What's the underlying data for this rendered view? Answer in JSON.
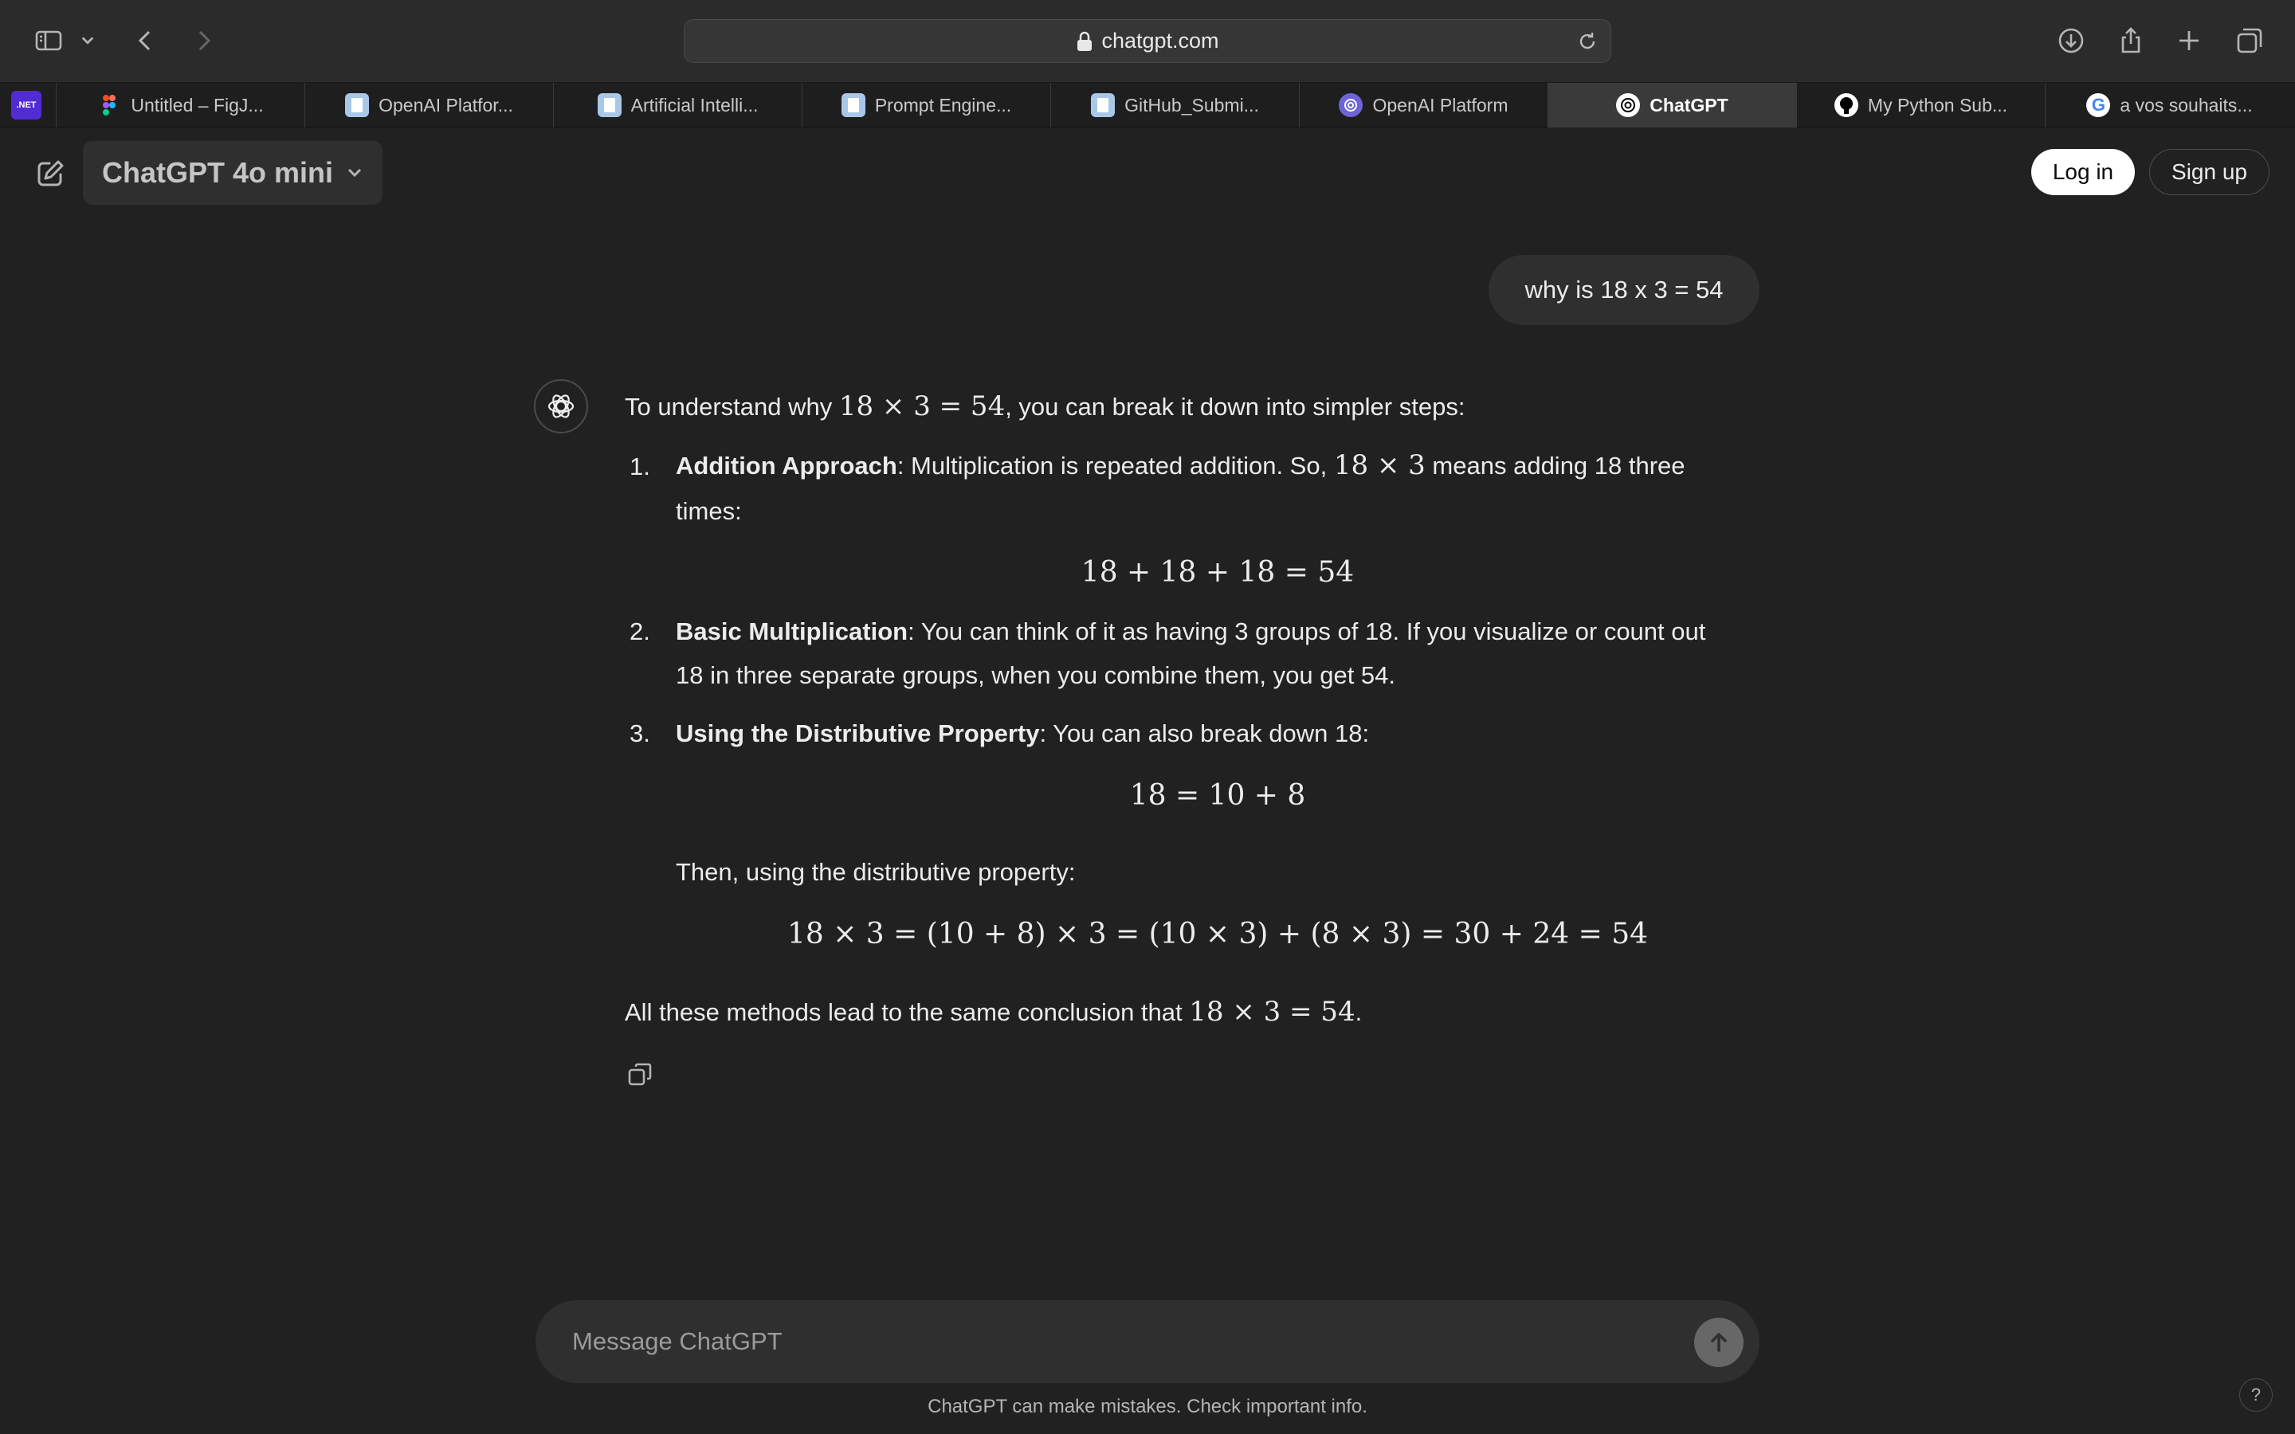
{
  "browser": {
    "address": "chatgpt.com",
    "pinned_tab": ".NET",
    "tabs": [
      {
        "label": "Untitled – FigJ...",
        "icon": "figma-icon"
      },
      {
        "label": "OpenAI Platfor...",
        "icon": "document-icon"
      },
      {
        "label": "Artificial Intelli...",
        "icon": "document-icon"
      },
      {
        "label": "Prompt Engine...",
        "icon": "document-icon"
      },
      {
        "label": "GitHub_Submi...",
        "icon": "document-icon"
      },
      {
        "label": "OpenAI Platform",
        "icon": "openai-icon"
      },
      {
        "label": "ChatGPT",
        "icon": "openai-icon",
        "active": true
      },
      {
        "label": "My Python Sub...",
        "icon": "github-icon"
      },
      {
        "label": "a vos souhaits...",
        "icon": "google-icon"
      }
    ]
  },
  "header": {
    "model": "ChatGPT 4o mini",
    "login": "Log in",
    "signup": "Sign up"
  },
  "conversation": {
    "user_message": "why is 18 x 3 = 54",
    "answer": {
      "intro_pre": "To understand why ",
      "intro_math": "18 × 3 = 54",
      "intro_post": ", you can break it down into simpler steps:",
      "items": [
        {
          "num": "1.",
          "title": "Addition Approach",
          "line1_pre": ": Multiplication is repeated addition. So, ",
          "line1_math": "18 × 3",
          "line1_post": " means adding 18 three",
          "line2": "times:",
          "display": "18 + 18 + 18 = 54"
        },
        {
          "num": "2.",
          "title": "Basic Multiplication",
          "line1": ": You can think of it as having 3 groups of 18. If you visualize or count out",
          "line2": "18 in three separate groups, when you combine them, you get 54."
        },
        {
          "num": "3.",
          "title": "Using the Distributive Property",
          "line1": ": You can also break down 18:",
          "display": "18 = 10 + 8",
          "then": "Then, using the distributive property:",
          "display2": "18 × 3 = (10 + 8) × 3 = (10 × 3) + (8 × 3) = 30 + 24 = 54"
        }
      ],
      "conclusion_pre": "All these methods lead to the same conclusion that ",
      "conclusion_math": "18 × 3 = 54",
      "conclusion_post": "."
    }
  },
  "composer": {
    "placeholder": "Message ChatGPT"
  },
  "footer": {
    "disclaimer": "ChatGPT can make mistakes. Check important info.",
    "help": "?"
  }
}
